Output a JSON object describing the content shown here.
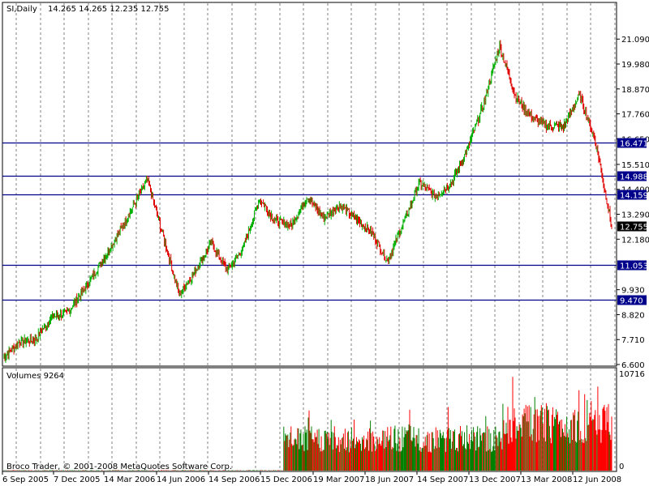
{
  "header": {
    "symbol": "SI,Daily",
    "ohlc": "14.265 14.265 12.235 12.755"
  },
  "volume_header": "Volumes 9264",
  "copyright": "Broco Trader, © 2001-2008 MetaQuotes Software Corp.",
  "price_axis_labels": [
    "21.090",
    "19.980",
    "18.870",
    "17.760",
    "16.650",
    "15.510",
    "14.400",
    "13.290",
    "12.180",
    "9.930",
    "8.820",
    "7.710",
    "6.600"
  ],
  "volume_axis_labels": [
    "10716",
    "0"
  ],
  "time_labels": [
    "6 Sep 2005",
    "7 Dec 2005",
    "14 Mar 2006",
    "14 Jun 2006",
    "14 Sep 2006",
    "15 Dec 2006",
    "19 Mar 2007",
    "18 Jun 2007",
    "14 Sep 2007",
    "13 Dec 2007",
    "13 Mar 2008",
    "12 Jun 2008"
  ],
  "levels": [
    {
      "value": 16.471,
      "label": "16.471"
    },
    {
      "value": 14.988,
      "label": "14.988"
    },
    {
      "value": 14.159,
      "label": "14.159"
    },
    {
      "value": 11.053,
      "label": "11.053"
    },
    {
      "value": 9.47,
      "label": "9.470"
    }
  ],
  "current_price": {
    "value": 12.755,
    "label": "12.755"
  },
  "colors": {
    "up": "#00b000",
    "down": "#e00000",
    "level": "#00008b",
    "volume_up": "#008000",
    "volume_down": "#ff0000",
    "grid": "#808080"
  },
  "chart_data": {
    "type": "line",
    "title": "",
    "price_range": [
      6.6,
      21.64
    ],
    "volume_range": [
      0,
      10716
    ],
    "series": [
      {
        "points": [
          [
            "6 Sep 2005",
            6.9
          ],
          [
            "Oct 2005",
            7.6
          ],
          [
            "Nov 2005",
            7.7
          ],
          [
            "7 Dec 2005",
            8.7
          ],
          [
            "Jan 2006",
            8.9
          ],
          [
            "Feb 2006",
            9.9
          ],
          [
            "Mar 2006",
            11.0
          ],
          [
            "14 Mar 2006",
            12.2
          ],
          [
            "Apr 2006",
            13.5
          ],
          [
            "May 2006",
            14.8
          ],
          [
            "late May 2006",
            12.3
          ],
          [
            "14 Jun 2006",
            9.7
          ],
          [
            "Jul 2006",
            10.8
          ],
          [
            "Aug 2006",
            12.0
          ],
          [
            "14 Sep 2006",
            10.8
          ],
          [
            "Oct 2006",
            11.8
          ],
          [
            "Nov 2006",
            14.0
          ],
          [
            "15 Dec 2006",
            13.0
          ],
          [
            "Jan 2007",
            12.8
          ],
          [
            "Feb 2007",
            14.1
          ],
          [
            "19 Mar 2007",
            13.1
          ],
          [
            "Apr 2007",
            13.7
          ],
          [
            "May 2007",
            13.1
          ],
          [
            "18 Jun 2007",
            12.5
          ],
          [
            "Aug 2007",
            11.2
          ],
          [
            "14 Sep 2007",
            12.9
          ],
          [
            "Oct 2007",
            14.7
          ],
          [
            "Nov 2007",
            14.1
          ],
          [
            "13 Dec 2007",
            14.7
          ],
          [
            "Jan 2008",
            16.2
          ],
          [
            "Feb 2008",
            18.2
          ],
          [
            "early Mar 2008",
            20.8
          ],
          [
            "13 Mar 2008",
            18.5
          ],
          [
            "Apr 2008",
            17.6
          ],
          [
            "May 2008",
            17.2
          ],
          [
            "12 Jun 2008",
            17.2
          ],
          [
            "Jul 2008",
            18.6
          ],
          [
            "late Jul 2008",
            16.5
          ],
          [
            "Aug 2008",
            12.755
          ]
        ]
      }
    ]
  }
}
